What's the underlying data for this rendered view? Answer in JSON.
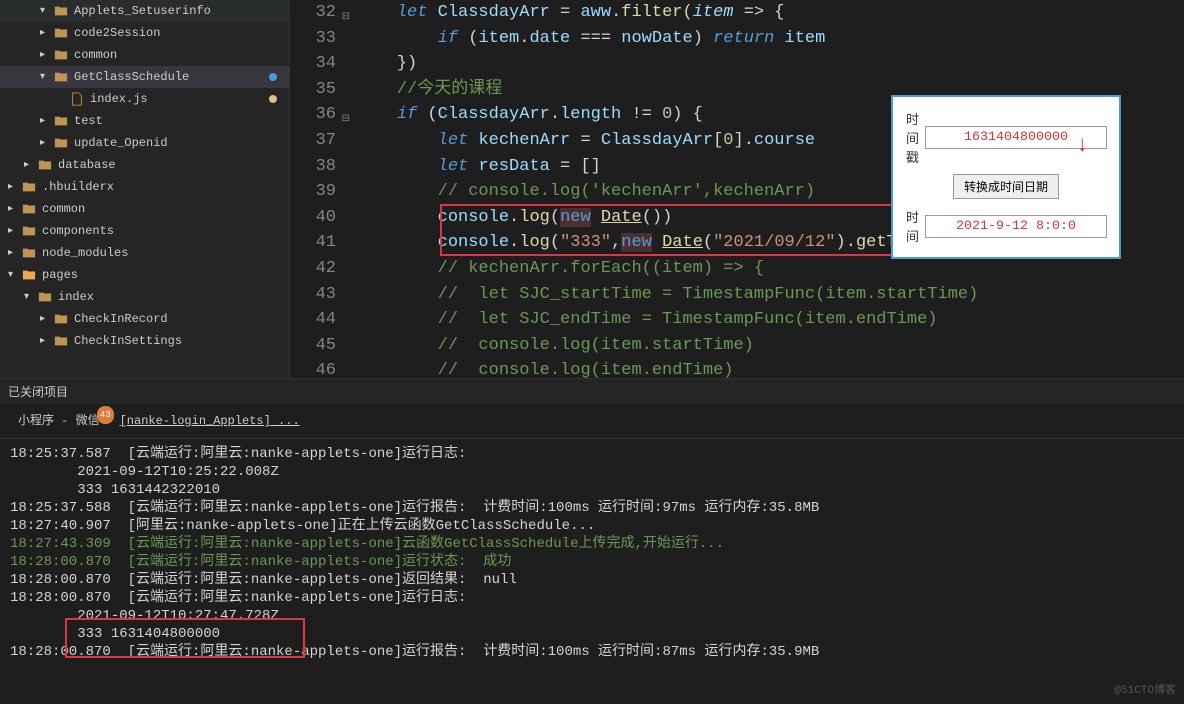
{
  "sidebar": {
    "items": [
      {
        "chev": "▾",
        "icon": "folder",
        "label": "Applets_Setuserinfo",
        "depth": 2
      },
      {
        "chev": "▸",
        "icon": "folder",
        "label": "code2Session",
        "depth": 2
      },
      {
        "chev": "▸",
        "icon": "folder",
        "label": "common",
        "depth": 2
      },
      {
        "chev": "▾",
        "icon": "folder",
        "label": "GetClassSchedule",
        "depth": 2,
        "sel": true,
        "dot": "blue"
      },
      {
        "chev": "",
        "icon": "file",
        "label": "index.js",
        "depth": 3,
        "dot": "yellow"
      },
      {
        "chev": "▸",
        "icon": "folder",
        "label": "test",
        "depth": 2
      },
      {
        "chev": "▸",
        "icon": "folder",
        "label": "update_Openid",
        "depth": 2
      },
      {
        "chev": "▸",
        "icon": "folder",
        "label": "database",
        "depth": 1
      },
      {
        "chev": "▸",
        "icon": "folder",
        "label": ".hbuilderx",
        "depth": 0
      },
      {
        "chev": "▸",
        "icon": "folder",
        "label": "common",
        "depth": 0
      },
      {
        "chev": "▸",
        "icon": "folder",
        "label": "components",
        "depth": 0
      },
      {
        "chev": "▸",
        "icon": "folder",
        "label": "node_modules",
        "depth": 0
      },
      {
        "chev": "▾",
        "icon": "folder",
        "label": "pages",
        "depth": 0,
        "orange": true
      },
      {
        "chev": "▾",
        "icon": "folder",
        "label": "index",
        "depth": 1
      },
      {
        "chev": "▸",
        "icon": "folder",
        "label": "CheckInRecord",
        "depth": 2
      },
      {
        "chev": "▸",
        "icon": "folder",
        "label": "CheckInSettings",
        "depth": 2
      }
    ],
    "closed": "已关闭项目"
  },
  "code": {
    "lines": [
      {
        "n": "32",
        "fold": "⊟"
      },
      {
        "n": "33"
      },
      {
        "n": "34"
      },
      {
        "n": "35"
      },
      {
        "n": "36",
        "fold": "⊟"
      },
      {
        "n": "37"
      },
      {
        "n": "38"
      },
      {
        "n": "39"
      },
      {
        "n": "40"
      },
      {
        "n": "41"
      },
      {
        "n": "42"
      },
      {
        "n": "43"
      },
      {
        "n": "44"
      },
      {
        "n": "45"
      },
      {
        "n": "46"
      }
    ],
    "t": {
      "let": "let",
      "if": "if",
      "return": "return",
      "new": "new",
      "ClassdayArr": "ClassdayArr",
      "aww": "aww",
      "filter": "filter",
      "item": "item",
      "date": "date",
      "nowDate": "nowDate",
      "length": "length",
      "kechenArr": "kechenArr",
      "course": "course",
      "resData": "resData",
      "console": "console",
      "log": "log",
      "Date": "Date",
      "getTime": "getTime",
      "cm1": "//今天的课程",
      "cm2": "// console.log('kechenArr',kechenArr)",
      "str333": "\"333\"",
      "strDate": "\"2021/09/12\"",
      "cm3": "// kechenArr.forEach((item) => {",
      "cm4": "//  let SJC_startTime = TimestampFunc(item.startTime)",
      "cm5": "//  let SJC_endTime = TimestampFunc(item.endTime)",
      "cm6": "//  console.log(item.startTime)",
      "cm7": "//  console.log(item.endTime)"
    }
  },
  "popup": {
    "label1": "时间戳",
    "val1": "1631404800000",
    "btn": "转换成时间日期",
    "label2": "时间",
    "val2": "2021-9-12 8:0:0"
  },
  "term": {
    "tab1": "小程序 - 微信",
    "badge": "43",
    "tab2": "[nanke-login_Applets] ...",
    "lines": [
      "18:25:37.587  [云端运行:阿里云:nanke-applets-one]运行日志:",
      "        2021-09-12T10:25:22.008Z",
      "        333 1631442322010",
      "18:25:37.588  [云端运行:阿里云:nanke-applets-one]运行报告:  计费时间:100ms 运行时间:97ms 运行内存:35.8MB",
      "",
      "18:27:40.907  [阿里云:nanke-applets-one]正在上传云函数GetClassSchedule...",
      "18:27:43.309  [云端运行:阿里云:nanke-applets-one]云函数GetClassSchedule上传完成,开始运行...",
      "18:28:00.870  [云端运行:阿里云:nanke-applets-one]运行状态:  成功",
      "18:28:00.870  [云端运行:阿里云:nanke-applets-one]返回结果:  null",
      "18:28:00.870  [云端运行:阿里云:nanke-applets-one]运行日志:",
      "        2021-09-12T10:27:47.728Z",
      "        333 1631404800000",
      "18:28:00.870  [云端运行:阿里云:nanke-applets-one]运行报告:  计费时间:100ms 运行时间:87ms 运行内存:35.9MB"
    ]
  },
  "watermark": "@51CTO博客"
}
